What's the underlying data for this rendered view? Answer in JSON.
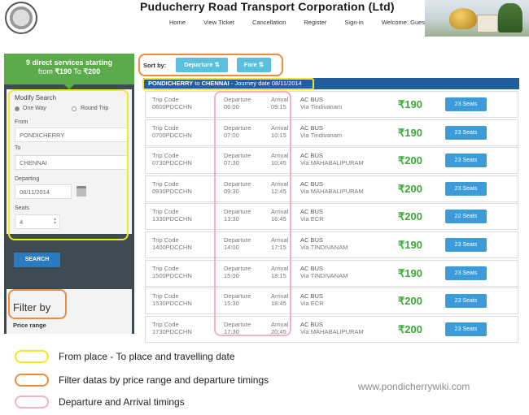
{
  "header": {
    "title": "Puducherry Road Transport Corporation (Ltd)",
    "nav": [
      "Home",
      "View Ticket",
      "Cancellation",
      "Register",
      "Sign-in",
      "Welcome: Guest"
    ]
  },
  "sidebar": {
    "promo_line1": "9 direct services starting",
    "promo_line2_prefix": "from ",
    "promo_from_price": "₹190",
    "promo_to": " To ",
    "promo_to_price": "₹200",
    "modify_search": "Modify Search",
    "one_way": "One Way",
    "round_trip": "Round Trip",
    "from_label": "From",
    "from_value": "PONDICHERRY",
    "to_label": "To",
    "to_value": "CHENNAI",
    "departing_label": "Departing",
    "departing_value": "08/11/2014",
    "seats_label": "Seats",
    "seats_value": "4",
    "search_button": "SEARCH",
    "filter_title": "Filter by",
    "price_range": "Price range"
  },
  "results": {
    "sort_by": "Sort by:",
    "sort_departure": "Departure ⇅",
    "sort_fare": "Fare ⇅",
    "journey_from": "PONDICHERRY",
    "journey_to_word": " to ",
    "journey_to": "CHENNAI",
    "journey_date": " - Journey date 08/11/2014",
    "col_trip": "Trip Code",
    "col_departure": "Departure",
    "col_arrival": "Arrival",
    "rows": [
      {
        "code": "0600PDCCHN",
        "dep": "06:00",
        "arr": "09:15",
        "bus": "AC BUS",
        "via": "Via Tindivanam",
        "price": "₹190",
        "seats": "23 Seats"
      },
      {
        "code": "0700PDCCHN",
        "dep": "07:00",
        "arr": "10:15",
        "bus": "AC BUS",
        "via": "Via Tindivanam",
        "price": "₹190",
        "seats": "23 Seats"
      },
      {
        "code": "0730PDCCHN",
        "dep": "07:30",
        "arr": "10:45",
        "bus": "AC BUS",
        "via": "Via MAHABALIPURAM",
        "price": "₹200",
        "seats": "23 Seats"
      },
      {
        "code": "0930PDCCHN",
        "dep": "09:30",
        "arr": "12:45",
        "bus": "AC BUS",
        "via": "Via MAHABALIPURAM",
        "price": "₹200",
        "seats": "23 Seats"
      },
      {
        "code": "1330PDCCHN",
        "dep": "13:30",
        "arr": "16:45",
        "bus": "AC BUS",
        "via": "Via ECR",
        "price": "₹200",
        "seats": "22 Seats"
      },
      {
        "code": "1400PDCCHN",
        "dep": "14:00",
        "arr": "17:15",
        "bus": "AC BUS",
        "via": "Via TINDIVANAM",
        "price": "₹190",
        "seats": "23 Seats"
      },
      {
        "code": "1500PDCCHN",
        "dep": "15:00",
        "arr": "18:15",
        "bus": "AC BUS",
        "via": "Via TINDIVANAM",
        "price": "₹190",
        "seats": "23 Seats"
      },
      {
        "code": "1530PDCCHN",
        "dep": "15:30",
        "arr": "18:45",
        "bus": "AC BUS",
        "via": "Via ECR",
        "price": "₹200",
        "seats": "23 Seats"
      },
      {
        "code": "1730PDCCHN",
        "dep": "17:30",
        "arr": "20:45",
        "bus": "AC BUS",
        "via": "Via MAHABALIPURAM",
        "price": "₹200",
        "seats": "23 Seats"
      }
    ]
  },
  "legend": [
    {
      "text": "From place - To place and travelling date",
      "color": "#f3e52a"
    },
    {
      "text": "Filter datas by price range and departure timings",
      "color": "#f08a3c"
    },
    {
      "text": "Departure and Arrival timings",
      "color": "#f3b0cd"
    }
  ],
  "watermark": "www.pondicherrywiki.com",
  "colors": {
    "accent": "#5cab4b",
    "brand_blue": "#1f5f9e",
    "price_green": "#3aa93a",
    "seats_blue": "#3d9bd8"
  }
}
